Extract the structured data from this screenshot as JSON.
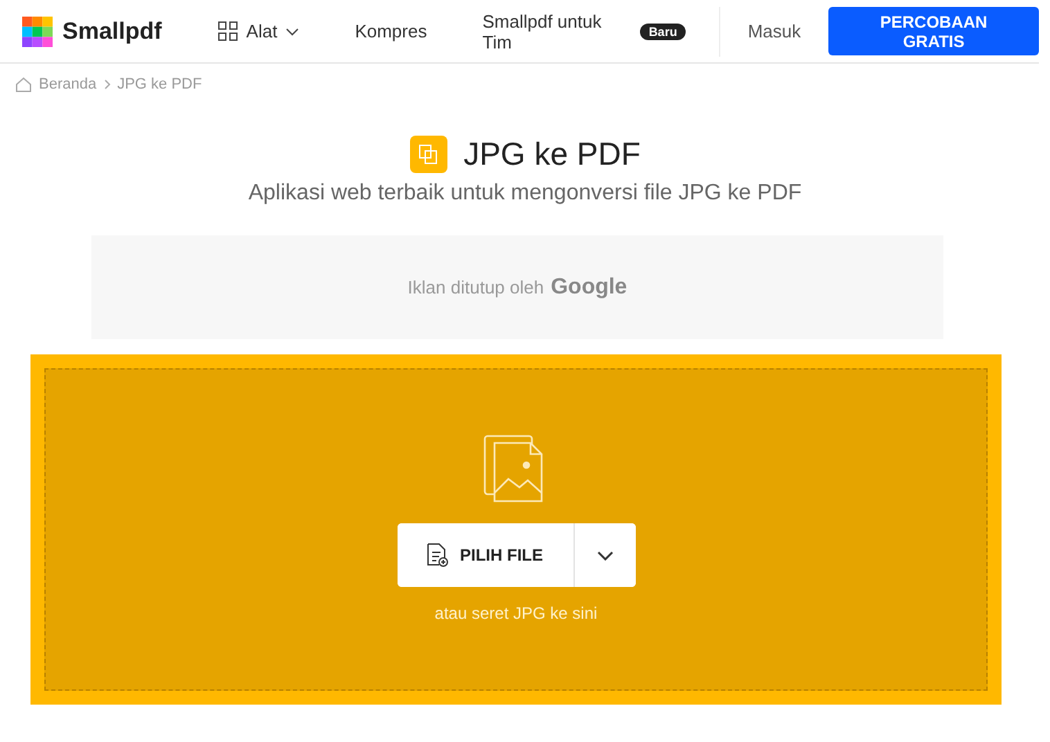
{
  "header": {
    "logo": "Smallpdf",
    "nav": [
      {
        "kind": "menu",
        "label": "Alat"
      },
      {
        "kind": "link",
        "label": "Kompres"
      }
    ],
    "team": {
      "label": "Smallpdf untuk Tim",
      "badge": "Baru"
    },
    "login": "Masuk",
    "cta": "PERCOBAAN GRATIS"
  },
  "breadcrumb": [
    "Beranda",
    "JPG ke PDF"
  ],
  "title": "JPG ke PDF",
  "subtitle": "Aplikasi web terbaik untuk mengonversi file JPG ke PDF",
  "ad": {
    "text": "Iklan ditutup oleh",
    "brand": "Google"
  },
  "dropzone": {
    "button": "PILIH FILE",
    "hint": "atau seret JPG ke sini"
  }
}
